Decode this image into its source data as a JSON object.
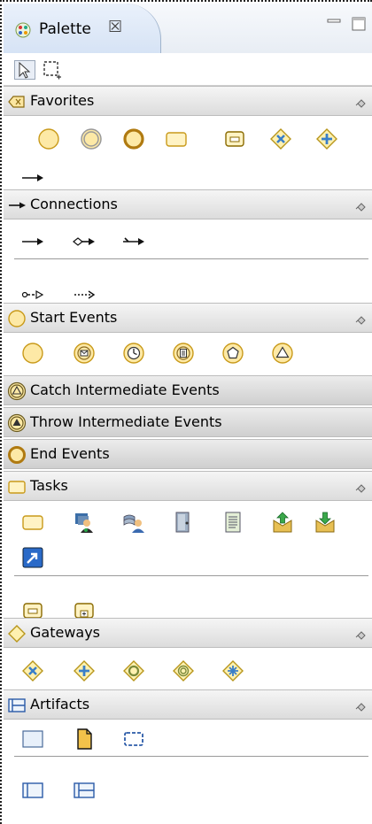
{
  "view": {
    "tab_title": "Palette",
    "close_glyph": "☒",
    "buttons": [
      "minimize-icon",
      "maximize-icon"
    ]
  },
  "tools": [
    "select-arrow-icon",
    "marquee-select-icon"
  ],
  "drawers": [
    {
      "id": "favorites",
      "label": "Favorites",
      "pin": "pin-icon",
      "items": [
        "start-event-icon",
        "intermediate-event-icon",
        "end-event-icon",
        "task-icon",
        "sub-process-icon",
        "exclusive-gateway-icon",
        "parallel-gateway-icon",
        "sequence-flow-icon"
      ]
    },
    {
      "id": "connections",
      "label": "Connections",
      "pin": "pin-icon",
      "items": [
        "sequence-flow-icon",
        "conditional-flow-icon",
        "default-flow-icon",
        "message-flow-icon",
        "association-icon"
      ]
    },
    {
      "id": "start-events",
      "label": "Start Events",
      "pin": "pin-icon",
      "items": [
        "start-event-icon",
        "message-start-event-icon",
        "timer-start-event-icon",
        "conditional-start-event-icon",
        "multiple-start-event-icon",
        "signal-start-event-icon"
      ]
    },
    {
      "id": "catch-intermediate-events",
      "label": "Catch Intermediate Events",
      "collapsed": true
    },
    {
      "id": "throw-intermediate-events",
      "label": "Throw Intermediate Events",
      "collapsed": true
    },
    {
      "id": "end-events",
      "label": "End Events",
      "collapsed": true
    },
    {
      "id": "tasks",
      "label": "Tasks",
      "pin": "pin-icon",
      "items": [
        "task-icon",
        "user-task-icon",
        "manual-task-icon",
        "service-task-icon",
        "script-task-icon",
        "send-task-icon",
        "receive-task-icon",
        "call-activity-icon",
        "sub-process-icon",
        "embedded-sub-process-icon"
      ]
    },
    {
      "id": "gateways",
      "label": "Gateways",
      "pin": "pin-icon",
      "items": [
        "exclusive-gateway-icon",
        "parallel-gateway-icon",
        "inclusive-gateway-icon",
        "event-gateway-icon",
        "complex-gateway-icon"
      ]
    },
    {
      "id": "artifacts",
      "label": "Artifacts",
      "pin": "pin-icon",
      "items": [
        "text-annotation-icon",
        "data-object-icon",
        "group-icon",
        "pool-icon",
        "lane-icon"
      ]
    }
  ],
  "colors": {
    "event_fill": "#fde9a6",
    "event_stroke": "#c99a1a",
    "gateway_fill": "#fff1b0",
    "gateway_stroke": "#b8961c",
    "gateway_mark": "#3a7fc9",
    "task_fill": "#fff3c4",
    "lane_stroke": "#2a5aa8"
  }
}
